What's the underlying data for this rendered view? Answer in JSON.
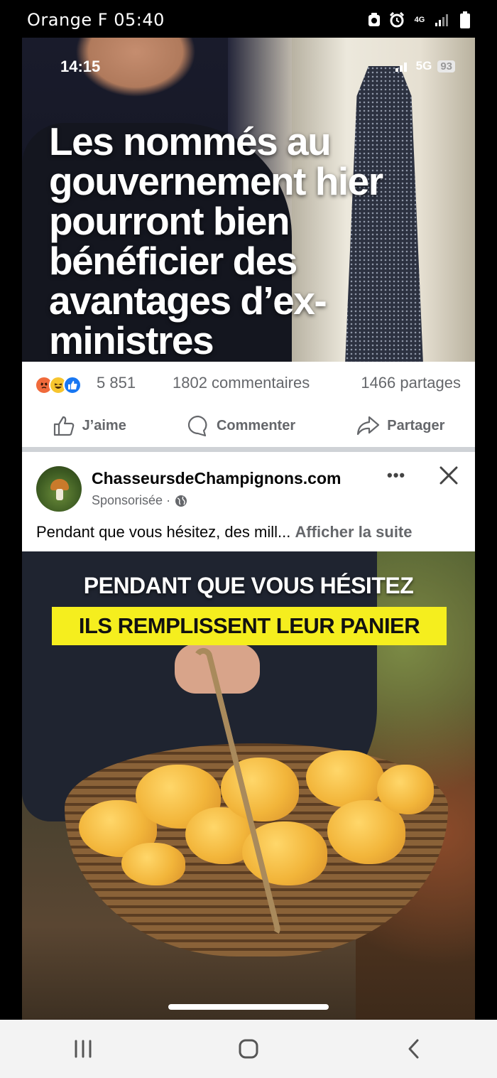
{
  "status_bar": {
    "carrier": "Orange F",
    "time": "05:40",
    "network": "4G"
  },
  "news_post": {
    "screenshot_time": "14:15",
    "screenshot_network": "5G",
    "screenshot_battery": "93",
    "headline": "Les nommés au gouvernement hier pourront bien bénéficier des avantages d’ex-ministres",
    "reaction_count": "5 851",
    "comments_count": "1802 commentaires",
    "shares_count": "1466 partages",
    "actions": {
      "like": "J’aime",
      "comment": "Commenter",
      "share": "Partager"
    }
  },
  "sponsored_post": {
    "page_name": "ChasseursdeChampignons.com",
    "sponsored_label": "Sponsorisée ·",
    "more_icon": "•••",
    "text": "Pendant que vous hésitez, des mill...",
    "see_more": "Afficher la suite",
    "ad_line1": "PENDANT QUE VOUS HÉSITEZ",
    "ad_line2": "ILS REMPLISSENT LEUR PANIER"
  },
  "colors": {
    "facebook_blue": "#1877f2",
    "secondary_text": "#65676b",
    "ad_highlight": "#f5ee1e"
  },
  "nav_icons": [
    "recents-icon",
    "home-icon",
    "back-icon"
  ]
}
